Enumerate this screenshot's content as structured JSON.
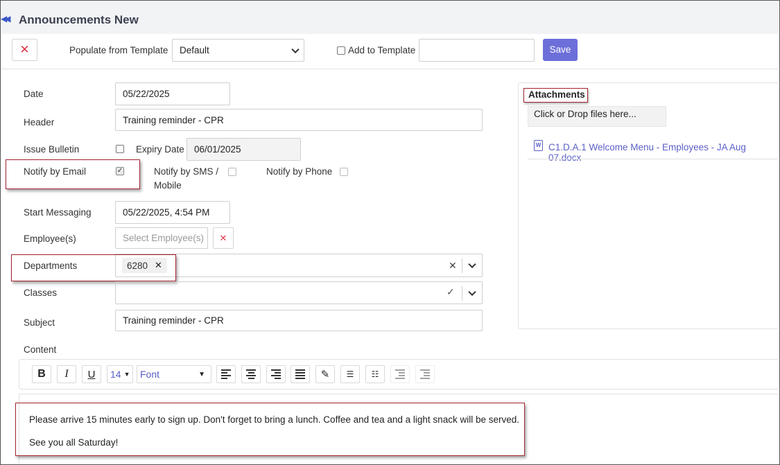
{
  "header": {
    "title": "Announcements New"
  },
  "toolbar": {
    "populate_label": "Populate from Template",
    "template_value": "Default",
    "add_to_template_label": "Add to Template",
    "template_name_value": "",
    "save_label": "Save"
  },
  "form": {
    "date_label": "Date",
    "date_value": "05/22/2025",
    "header_label": "Header",
    "header_value": "Training reminder - CPR",
    "issue_bulletin_label": "Issue Bulletin",
    "expiry_label": "Expiry Date",
    "expiry_value": "06/01/2025",
    "notify_email_label": "Notify by Email",
    "notify_email_checked": true,
    "notify_sms_label_1": "Notify by SMS /",
    "notify_sms_label_2": "Mobile",
    "notify_phone_label": "Notify by Phone",
    "start_messaging_label": "Start Messaging",
    "start_messaging_value": "05/22/2025, 4:54 PM",
    "employees_label": "Employee(s)",
    "employees_placeholder": "Select Employee(s)",
    "departments_label": "Departments",
    "departments_tags": [
      "6280"
    ],
    "classes_label": "Classes",
    "subject_label": "Subject",
    "subject_value": "Training reminder - CPR",
    "content_label": "Content"
  },
  "attachments": {
    "title": "Attachments",
    "drop_label": "Click or Drop files here...",
    "files": [
      "C1.D.A.1 Welcome Menu - Employees - JA Aug 07.docx"
    ]
  },
  "editor": {
    "bold": "B",
    "italic": "I",
    "underline": "U",
    "font_size": "14",
    "font_name": "Font",
    "paragraphs": [
      "Please arrive 15 minutes early to sign up. Don't forget to bring a lunch. Coffee and tea and a light snack will be served.",
      "See you all Saturday!"
    ]
  },
  "colors": {
    "accent": "#6c6fd9",
    "link": "#5b5fc7",
    "danger": "#e0364a",
    "highlight_box": "#a3222e"
  }
}
